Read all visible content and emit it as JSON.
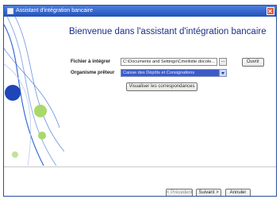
{
  "window": {
    "title": "Assistant d'intégration bancaire"
  },
  "heading": "Bienvenue dans l'assistant d'intégration bancaire",
  "form": {
    "file_label": "Fichier à intégrer",
    "file_value": "C:\\Documents and Settings\\Cmellotte.docole...",
    "browse_label": "...",
    "open_label": "Ouvrir",
    "org_label": "Organisme prêteur",
    "org_value": "Caisse des Dépôts et Consignations"
  },
  "view_mapping_label": "Visualiser les correspondances",
  "footer": {
    "prev_label": "< Précédent",
    "next_label": "Suivant >",
    "cancel_label": "Annuler"
  },
  "colors": {
    "title_bar": "#2352b8",
    "heading": "#1c2f8a",
    "selection": "#3d5bc8"
  },
  "icons": [
    "app-icon",
    "close-icon",
    "dropdown-arrow-icon"
  ]
}
